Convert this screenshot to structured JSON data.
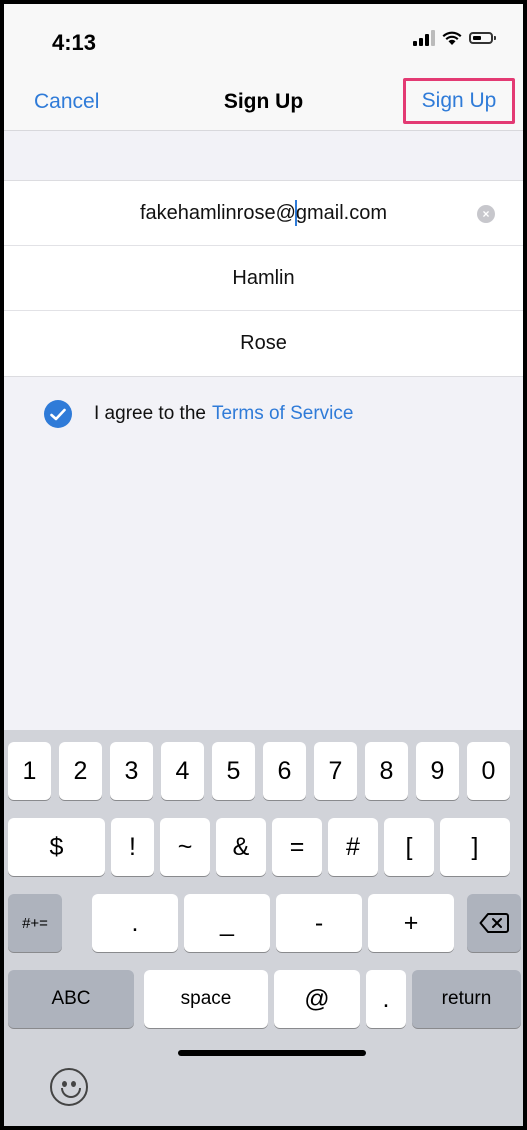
{
  "status_bar": {
    "time": "4:13"
  },
  "nav": {
    "cancel_label": "Cancel",
    "title": "Sign Up",
    "signup_label": "Sign Up"
  },
  "form": {
    "email_before_caret": "fakehamlinrose@",
    "email_after_caret": "gmail.com",
    "first_name": "Hamlin",
    "last_name": "Rose"
  },
  "agree": {
    "text": "I agree to the",
    "link": "Terms of Service",
    "checked": true
  },
  "keyboard": {
    "row1": [
      "1",
      "2",
      "3",
      "4",
      "5",
      "6",
      "7",
      "8",
      "9",
      "0"
    ],
    "row2": [
      "$",
      "!",
      "~",
      "&",
      "=",
      "#",
      "[",
      "]"
    ],
    "row3_symbols": ".",
    "row3_keys": [
      ".",
      "_",
      "-",
      "+"
    ],
    "symbols_toggle": "#+=",
    "abc": "ABC",
    "space": "space",
    "at": "@",
    "dot": ".",
    "return": "return"
  },
  "colors": {
    "accent": "#2f7bd8",
    "highlight_border": "#e33a73"
  },
  "icons": {
    "clear": "clear-icon",
    "delete": "backspace-icon",
    "emoji": "emoji-icon",
    "check": "checkmark-icon"
  }
}
